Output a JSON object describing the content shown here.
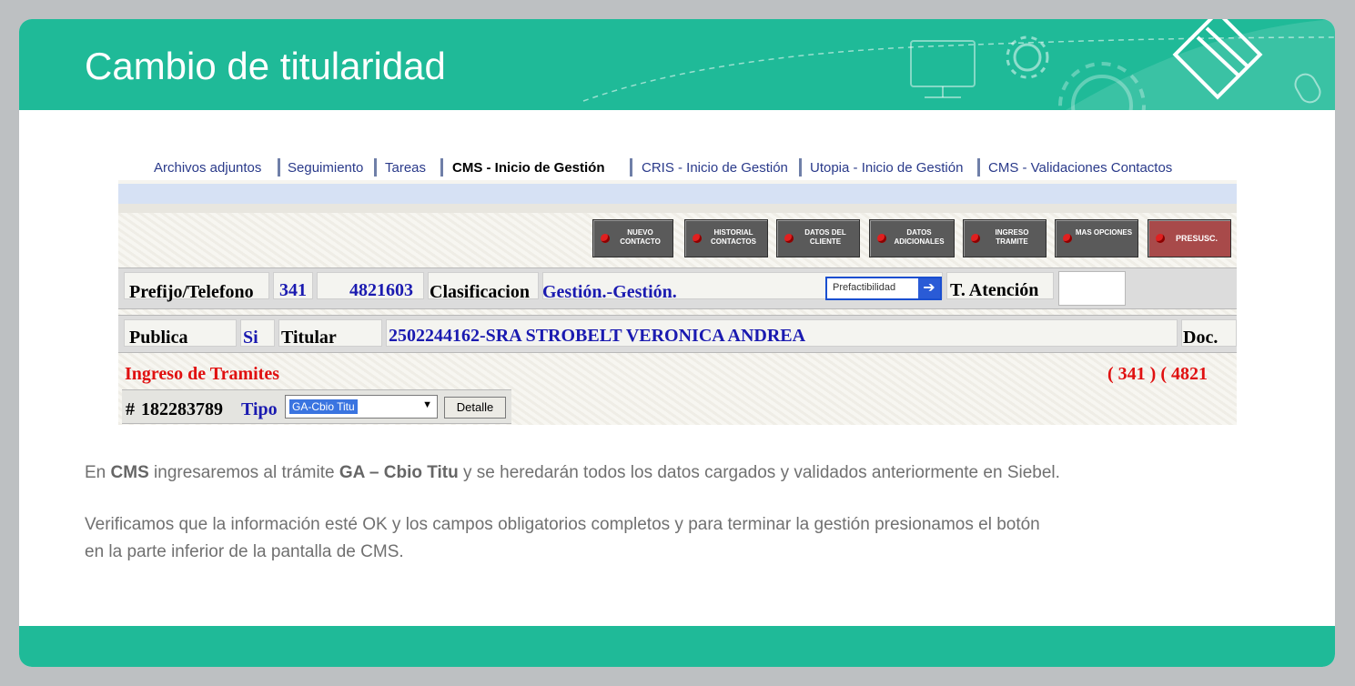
{
  "slide": {
    "title": "Cambio de titularidad",
    "colors": {
      "header": "#1fba98",
      "background": "#bdc0c2"
    }
  },
  "cms": {
    "tabs": [
      {
        "label": "Archivos adjuntos"
      },
      {
        "label": "Seguimiento"
      },
      {
        "label": "Tareas"
      },
      {
        "label": "CMS - Inicio de Gestión",
        "active": true
      },
      {
        "label": "CRIS - Inicio de Gestión"
      },
      {
        "label": "Utopia - Inicio de Gestión"
      },
      {
        "label": "CMS - Validaciones Contactos"
      }
    ],
    "toolbar": {
      "nuevo_contacto": "Nuevo Contacto",
      "historial_contactos": "Historial Contactos",
      "datos_cliente": "Datos del Cliente",
      "datos_adicionales": "Datos Adicionales",
      "ingreso_tramite": "Ingreso Tramite",
      "mas_opciones": "Mas Opciones",
      "presusc": "Presusc."
    },
    "row1": {
      "prefijo_label": "Prefijo/Telefono",
      "prefijo": "341",
      "telefono": "4821603",
      "clasificacion_label": "Clasificacion",
      "clasificacion": "Gestión.-Gestión.",
      "prefactibilidad": "Prefactibilidad",
      "atencion_label": "T. Atención",
      "atencion_value": ""
    },
    "row2": {
      "publica_label": "Publica",
      "publica": "Si",
      "titular_label": "Titular",
      "titular": "2502244162-SRA STROBELT VERONICA ANDREA",
      "doc_label": "Doc."
    },
    "ingreso": {
      "title": "Ingreso de Tramites",
      "phone": "( 341 ) ( 4821",
      "hash": "#",
      "numero": "182283789",
      "tipo_label": "Tipo",
      "tipo_value": "GA-Cbio Titu",
      "detalle_label": "Detalle"
    }
  },
  "text": {
    "p1": [
      {
        "t": "En ",
        "b": false
      },
      {
        "t": "CMS",
        "b": true
      },
      {
        "t": " ingresaremos al trámite ",
        "b": false
      },
      {
        "t": "GA – Cbio Titu",
        "b": true
      },
      {
        "t": " y se heredarán todos los datos cargados y validados anteriormente en Siebel.",
        "b": false
      }
    ],
    "p2_line1": "Verificamos que la información esté OK y los campos obligatorios completos y para terminar la gestión presionamos el botón",
    "p2_line2": "en la parte inferior de la pantalla de CMS."
  }
}
